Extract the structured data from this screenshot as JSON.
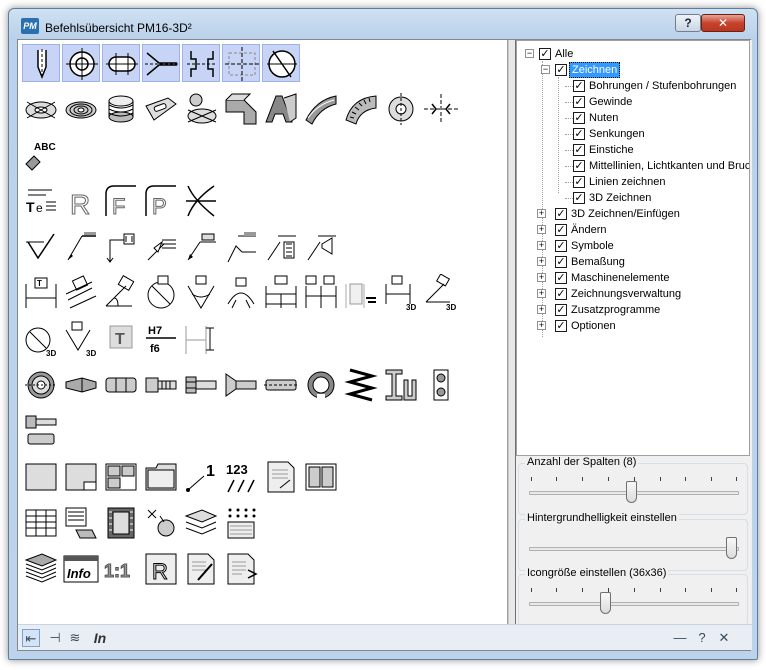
{
  "window": {
    "title": "Befehlsübersicht  PM16-3D²",
    "app_icon_text": "PM",
    "help_button": "?",
    "close_button": "✕"
  },
  "tree": {
    "expand_open": "−",
    "expand_closed": "+",
    "check": "✓",
    "root": "Alle",
    "items": [
      {
        "label": "Zeichnen",
        "expanded": true,
        "selected": true,
        "children": [
          "Bohrungen / Stufenbohrungen",
          "Gewinde",
          "Nuten",
          "Senkungen",
          "Einstiche",
          "Mittellinien, Lichtkanten und Bruc",
          "Linien zeichnen",
          "3D Zeichnen"
        ]
      },
      {
        "label": "3D Zeichnen/Einfügen"
      },
      {
        "label": "Ändern"
      },
      {
        "label": "Symbole"
      },
      {
        "label": "Bemaßung"
      },
      {
        "label": "Maschinenelemente"
      },
      {
        "label": "Zeichnungsverwaltung"
      },
      {
        "label": "Zusatzprogramme"
      },
      {
        "label": "Optionen"
      }
    ]
  },
  "sliders": {
    "columns": {
      "label": "Anzahl der Spalten (8)",
      "value": 8,
      "min": 1,
      "max": 15
    },
    "brightness": {
      "label": "Hintergrundhelligkeit einstellen",
      "value": 1.0
    },
    "icon_size": {
      "label": "Icongröße einstellen  (36x36)",
      "value": 0.37
    }
  },
  "statusbar": {
    "first_icon": "first-icon",
    "pin_icon": "pin-icon",
    "layers_icon": "layers-icon",
    "info_text": "In",
    "minimize": "—",
    "help": "?",
    "close": "✕"
  },
  "icon_texts": {
    "abc": "ABC",
    "r": "R",
    "f": "F",
    "p": "P",
    "t": "T",
    "h7": "H7",
    "f6": "f6",
    "n123": "123",
    "one_to_one": "1:1",
    "info": "Info",
    "one": "1",
    "three_d": "3D"
  },
  "colors": {
    "highlight": "#c7d4f5",
    "selection": "#3399ff"
  }
}
